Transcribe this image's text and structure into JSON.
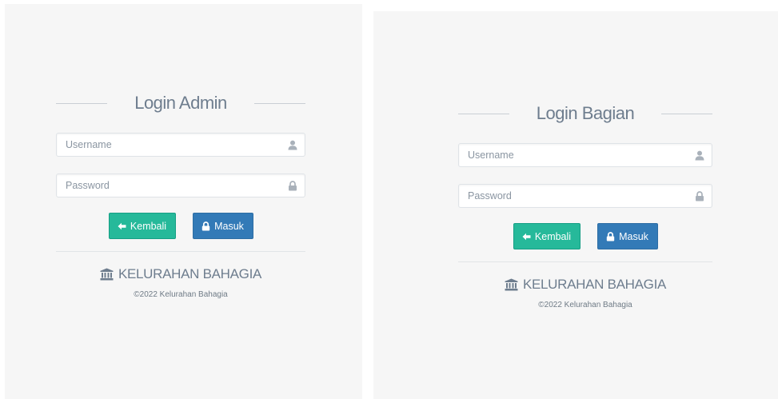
{
  "colors": {
    "panel_bg": "#f6f6f6",
    "back_button": "#26b99a",
    "login_button": "#337ab7",
    "text": "#73879c"
  },
  "admin": {
    "title": "Login Admin",
    "username_placeholder": "Username",
    "password_placeholder": "Password",
    "back_label": "Kembali",
    "login_label": "Masuk",
    "brand": "KELURAHAN BAHAGIA",
    "copyright": "©2022 Kelurahan Bahagia",
    "icons": [
      "user-icon",
      "lock-icon",
      "arrow-left-icon",
      "lock-icon",
      "bank-icon"
    ]
  },
  "bagian": {
    "title": "Login Bagian",
    "username_placeholder": "Username",
    "password_placeholder": "Password",
    "back_label": "Kembali",
    "login_label": "Masuk",
    "brand": "KELURAHAN BAHAGIA",
    "copyright": "©2022 Kelurahan Bahagia",
    "icons": [
      "user-icon",
      "lock-icon",
      "arrow-left-icon",
      "lock-icon",
      "bank-icon"
    ]
  }
}
